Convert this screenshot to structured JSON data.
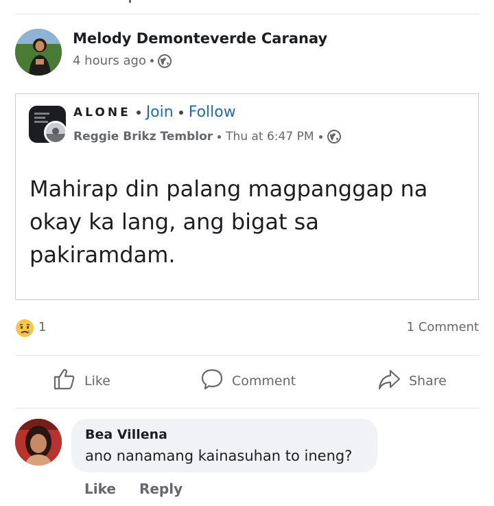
{
  "post": {
    "author": "Melody Demonteverde Caranay",
    "time": "4 hours ago",
    "privacy_icon": "globe-icon"
  },
  "shared": {
    "group_name": "ALONE",
    "join_label": "Join",
    "follow_label": "Follow",
    "author": "Reggie Brikz Temblor",
    "time": "Thu at 6:47 PM",
    "privacy_icon": "globe-icon",
    "text": "Mahirap din palang magpanggap na okay ka lang, ang bigat sa pakiramdam."
  },
  "reactions": {
    "emoji": "sad-emoji-icon",
    "count": "1",
    "comments": "1 Comment"
  },
  "actions": {
    "like": "Like",
    "comment": "Comment",
    "share": "Share"
  },
  "comment": {
    "author": "Bea Villena",
    "text": "ano nanamang kainasuhan to ineng?",
    "like": "Like",
    "reply": "Reply"
  },
  "colors": {
    "link": "#1d6ab4",
    "muted": "#65676b",
    "bubble": "#f0f2f5"
  }
}
